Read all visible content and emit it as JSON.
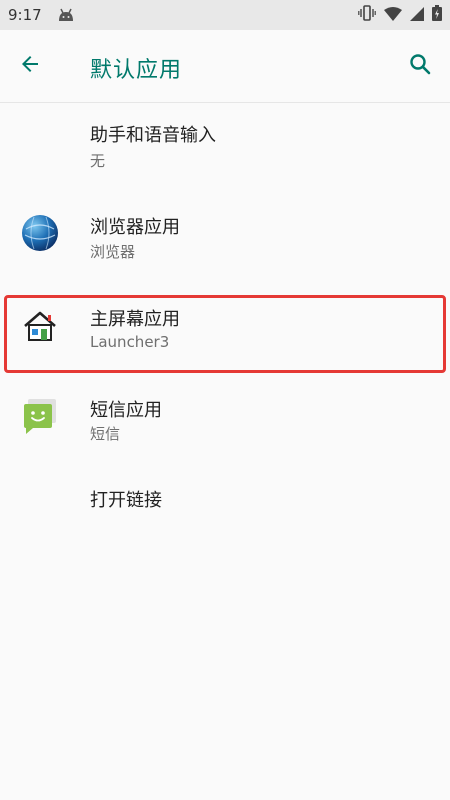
{
  "status_bar": {
    "time": "9:17",
    "icons": [
      "android-debug-icon",
      "vibrate-icon",
      "wifi-icon",
      "signal-icon",
      "battery-icon"
    ]
  },
  "app_bar": {
    "title": "默认应用",
    "back_icon": "arrow-left-icon",
    "search_icon": "search-icon"
  },
  "items": [
    {
      "title": "助手和语音输入",
      "subtitle": "无",
      "icon": ""
    },
    {
      "title": "浏览器应用",
      "subtitle": "浏览器",
      "icon": "globe-icon"
    },
    {
      "title": "主屏幕应用",
      "subtitle": "Launcher3",
      "icon": "home-icon"
    },
    {
      "title": "短信应用",
      "subtitle": "短信",
      "icon": "message-icon"
    },
    {
      "title": "打开链接",
      "subtitle": "",
      "icon": ""
    }
  ],
  "colors": {
    "accent": "#00796b",
    "highlight_border": "#e53935",
    "status_bar_bg": "#e8e8e8",
    "background": "#fafafa"
  }
}
